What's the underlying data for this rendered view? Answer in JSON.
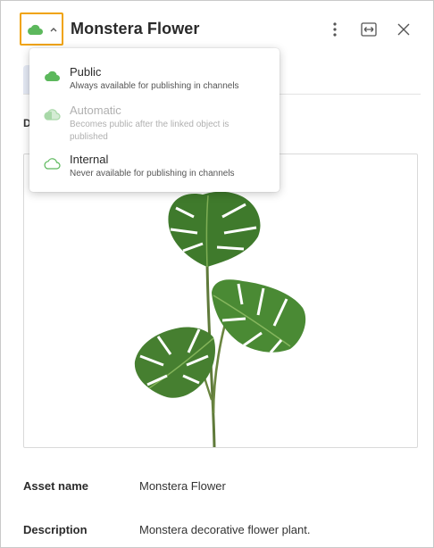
{
  "header": {
    "title": "Monstera Flower",
    "visibility_icon": "cloud-icon",
    "icons": [
      "cloud-icon",
      "chevron-up-icon",
      "more-vertical-icon",
      "expand-horizontal-icon",
      "close-icon"
    ]
  },
  "tabs": {
    "partial_label": "D"
  },
  "visibility_menu": {
    "options": [
      {
        "label": "Public",
        "description": "Always available for publishing in channels",
        "icon": "cloud-filled-icon",
        "enabled": true
      },
      {
        "label": "Automatic",
        "description": "Becomes public after the linked object is published",
        "icon": "cloud-half-icon",
        "enabled": false
      },
      {
        "label": "Internal",
        "description": "Never available for publishing in channels",
        "icon": "cloud-outline-icon",
        "enabled": true
      }
    ]
  },
  "fields": {
    "asset_name_label": "Asset name",
    "asset_name_value": "Monstera Flower",
    "description_label": "Description",
    "description_value": "Monstera decorative flower plant."
  },
  "colors": {
    "accent_border": "#f0a30a",
    "cloud_green": "#5cb85c",
    "cloud_green_light": "#a8d8a8",
    "tab_background": "#e4e9f4"
  }
}
